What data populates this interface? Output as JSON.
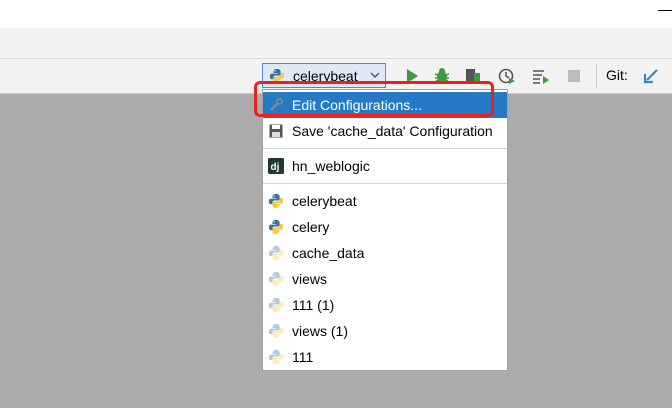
{
  "toolbar": {
    "run_config_label": "celerybeat",
    "git_label": "Git:"
  },
  "popup": {
    "actions": [
      {
        "label": "Edit Configurations...",
        "icon": "wrench-icon",
        "selected": true
      },
      {
        "label": "Save 'cache_data' Configuration",
        "icon": "save-icon",
        "selected": false
      }
    ],
    "django": {
      "label": "hn_weblogic",
      "icon": "django-icon"
    },
    "configs": [
      {
        "label": "celerybeat",
        "temporary": false
      },
      {
        "label": "celery",
        "temporary": false
      },
      {
        "label": "cache_data",
        "temporary": true
      },
      {
        "label": "views",
        "temporary": true
      },
      {
        "label": "111 (1)",
        "temporary": true
      },
      {
        "label": "views (1)",
        "temporary": true
      },
      {
        "label": "111",
        "temporary": true
      }
    ]
  },
  "colors": {
    "selection": "#2679c4",
    "highlight_box": "#e8231e",
    "run_green": "#3d9a3e",
    "python_blue": "#3772a4",
    "python_yellow": "#f5c93b"
  }
}
